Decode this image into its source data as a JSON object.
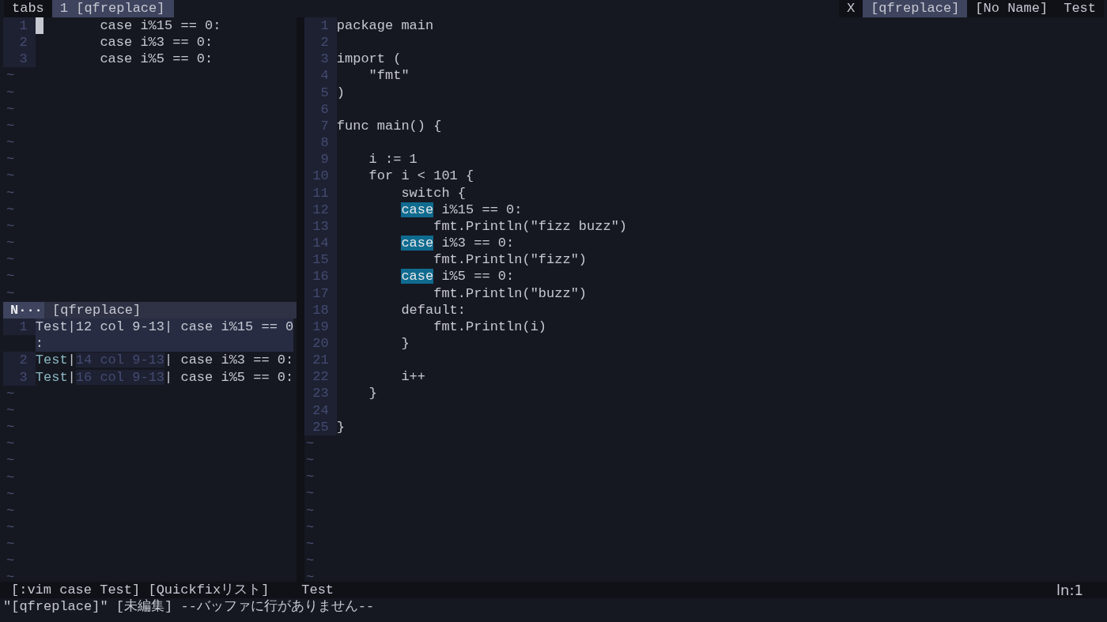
{
  "tabline": {
    "label": "tabs",
    "tabs": [
      {
        "label": "1 [qfreplace]",
        "selected": true
      }
    ],
    "close": "X",
    "buffers": [
      {
        "label": "[qfreplace]",
        "selected": true
      },
      {
        "label": "[No Name]",
        "selected": false
      },
      {
        "label": "Test",
        "selected": false
      }
    ]
  },
  "replace_window": {
    "lines": [
      {
        "number": "1",
        "text": "        case i%15 == 0:",
        "cursor": true
      },
      {
        "number": "2",
        "text": "        case i%3 == 0:",
        "cursor": false
      },
      {
        "number": "3",
        "text": "        case i%5 == 0:",
        "cursor": false
      }
    ],
    "filler": [
      "~",
      "~",
      "~",
      "~",
      "~",
      "~",
      "~",
      "~",
      "~",
      "~",
      "~",
      "~",
      "~",
      "~"
    ]
  },
  "replace_status": {
    "mode": "N···",
    "name": "[qfreplace]"
  },
  "quickfix": {
    "entries": [
      {
        "number": "1",
        "selected": true,
        "segments": [
          {
            "text": "Test",
            "kind": "file"
          },
          {
            "text": "|",
            "kind": "plain"
          },
          {
            "text": "12 col 9-13",
            "kind": "location"
          },
          {
            "text": "|",
            "kind": "plain"
          },
          {
            "text": " case i%15 == 0:",
            "kind": "plain"
          }
        ]
      },
      {
        "number": "2",
        "selected": false,
        "segments": [
          {
            "text": "Test",
            "kind": "file"
          },
          {
            "text": "|",
            "kind": "plain"
          },
          {
            "text": "14 col 9-13",
            "kind": "location"
          },
          {
            "text": "|",
            "kind": "plain"
          },
          {
            "text": " case i%3 == 0:",
            "kind": "plain"
          }
        ]
      },
      {
        "number": "3",
        "selected": false,
        "segments": [
          {
            "text": "Test",
            "kind": "file"
          },
          {
            "text": "|",
            "kind": "plain"
          },
          {
            "text": "16 col 9-13",
            "kind": "location"
          },
          {
            "text": "|",
            "kind": "plain"
          },
          {
            "text": " case i%5 == 0:",
            "kind": "plain"
          }
        ]
      }
    ],
    "filler": [
      "~",
      "~",
      "~",
      "~",
      "~",
      "~",
      "~",
      "~",
      "~",
      "~",
      "~",
      "~"
    ]
  },
  "editor": {
    "lines": [
      {
        "number": "1",
        "kind": "code",
        "segments": [
          {
            "text": "package main",
            "match": false
          }
        ]
      },
      {
        "number": "2"
      },
      {
        "number": "3",
        "kind": "code",
        "segments": [
          {
            "text": "import (",
            "match": false
          }
        ]
      },
      {
        "number": "4",
        "kind": "code",
        "segments": [
          {
            "text": "    \"fmt\"",
            "match": false
          }
        ]
      },
      {
        "number": "5",
        "kind": "code",
        "segments": [
          {
            "text": ")",
            "match": false
          }
        ]
      },
      {
        "number": "6"
      },
      {
        "number": "7",
        "kind": "code",
        "segments": [
          {
            "text": "func main() {",
            "match": false
          }
        ]
      },
      {
        "number": "8"
      },
      {
        "number": "9",
        "kind": "code",
        "segments": [
          {
            "text": "    i := 1",
            "match": false
          }
        ]
      },
      {
        "number": "10",
        "kind": "code",
        "segments": [
          {
            "text": "    for i < 101 {",
            "match": false
          }
        ]
      },
      {
        "number": "11",
        "kind": "code",
        "segments": [
          {
            "text": "        switch {",
            "match": false
          }
        ]
      },
      {
        "number": "12",
        "kind": "case_hit",
        "segments": [
          {
            "text": "case",
            "match": true
          },
          {
            "text": " i%15 == 0:",
            "match": false
          }
        ]
      },
      {
        "number": "13",
        "kind": "code",
        "segments": [
          {
            "text": "            fmt.Println(\"fizz buzz\")",
            "match": false
          }
        ]
      },
      {
        "number": "14",
        "kind": "case_hit",
        "segments": [
          {
            "text": "case",
            "match": true
          },
          {
            "text": " i%3 == 0:",
            "match": false
          }
        ]
      },
      {
        "number": "15",
        "kind": "code",
        "segments": [
          {
            "text": "            fmt.Println(\"fizz\")",
            "match": false
          }
        ]
      },
      {
        "number": "16",
        "kind": "case_hit",
        "segments": [
          {
            "text": "case",
            "match": true
          },
          {
            "text": " i%5 == 0:",
            "match": false
          }
        ]
      },
      {
        "number": "17",
        "kind": "code",
        "segments": [
          {
            "text": "            fmt.Println(\"buzz\")",
            "match": false
          }
        ]
      },
      {
        "number": "18",
        "kind": "code",
        "segments": [
          {
            "text": "        default:",
            "match": false
          }
        ]
      },
      {
        "number": "19",
        "kind": "code",
        "segments": [
          {
            "text": "            fmt.Println(i)",
            "match": false
          }
        ]
      },
      {
        "number": "20",
        "kind": "code",
        "segments": [
          {
            "text": "        }",
            "match": false
          }
        ]
      },
      {
        "number": "21"
      },
      {
        "number": "22",
        "kind": "code",
        "segments": [
          {
            "text": "        i++",
            "match": false
          }
        ]
      },
      {
        "number": "23",
        "kind": "code",
        "segments": [
          {
            "text": "    }",
            "match": false
          }
        ]
      },
      {
        "number": "24"
      },
      {
        "number": "25",
        "kind": "code",
        "segments": [
          {
            "text": "}",
            "match": false
          }
        ]
      }
    ],
    "filler": [
      "~",
      "~",
      "~",
      "~",
      "~",
      "~",
      "~",
      "~",
      "~"
    ]
  },
  "status": {
    "left": "[:vim case Test] [Quickfixリスト]",
    "file": "Test",
    "position": "ln:1"
  },
  "command_line": "\"[qfreplace]\" [未編集] --バッファに行がありません--"
}
